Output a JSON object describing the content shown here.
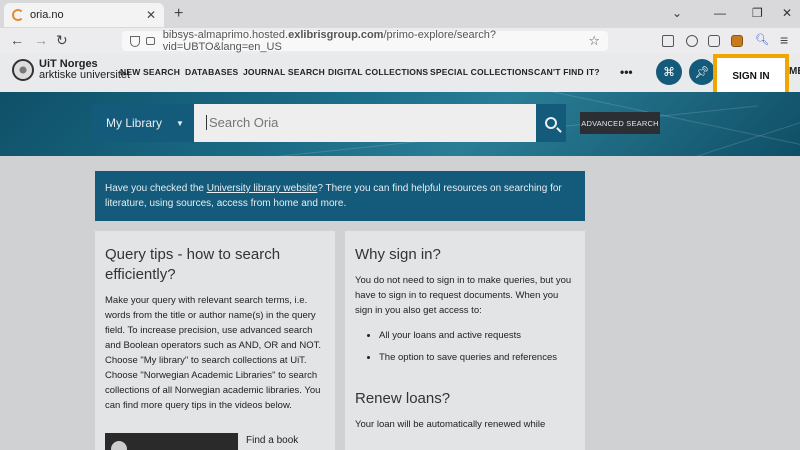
{
  "browser": {
    "tab_title": "oria.no",
    "url_prefix": "bibsys-almaprimo.hosted.",
    "url_host": "exlibrisgroup.com",
    "url_path": "/primo-explore/search?vid=UBTO&lang=en_US"
  },
  "header": {
    "logo_line1": "UiT Norges",
    "logo_line2": "arktiske universitet",
    "menu": [
      "NEW SEARCH",
      "DATABASES",
      "JOURNAL SEARCH",
      "DIGITAL COLLECTIONS",
      "SPECIAL COLLECTIONS",
      "CAN'T FIND IT?"
    ],
    "more": "•••",
    "sign_in": "SIGN IN",
    "overflow_text": "ME"
  },
  "search": {
    "scope_label": "My Library",
    "placeholder": "Search Oria",
    "advanced_label": "ADVANCED SEARCH"
  },
  "banner": {
    "before": "Have you checked the ",
    "link": "University library website",
    "after": "? There you can find helpful resources on searching for literature, using sources, access from home and more."
  },
  "query_tips": {
    "title": "Query tips - how to search efficiently?",
    "body": "Make your query with relevant search terms, i.e. words from the title or author name(s) in the query field. To increase precision, use advanced search and Boolean operators such as AND, OR and NOT. Choose \"My library\" to search collections at UiT. Choose \"Norwegian Academic Libraries\" to search collections of all Norwegian academic libraries. You can find more query tips in the videos below.",
    "video_label": "Find a book"
  },
  "sign_in_card": {
    "title": "Why sign in?",
    "body": "You do not need to sign in to make queries, but you have to sign in to request documents. When you sign in you also get access to:",
    "bullets": [
      "All your loans and active requests",
      "The option to save queries and references"
    ],
    "renew_title": "Renew loans?",
    "renew_body": "Your loan will be automatically renewed while"
  },
  "colors": {
    "primary": "#145a7a",
    "highlight": "#f0a500"
  }
}
